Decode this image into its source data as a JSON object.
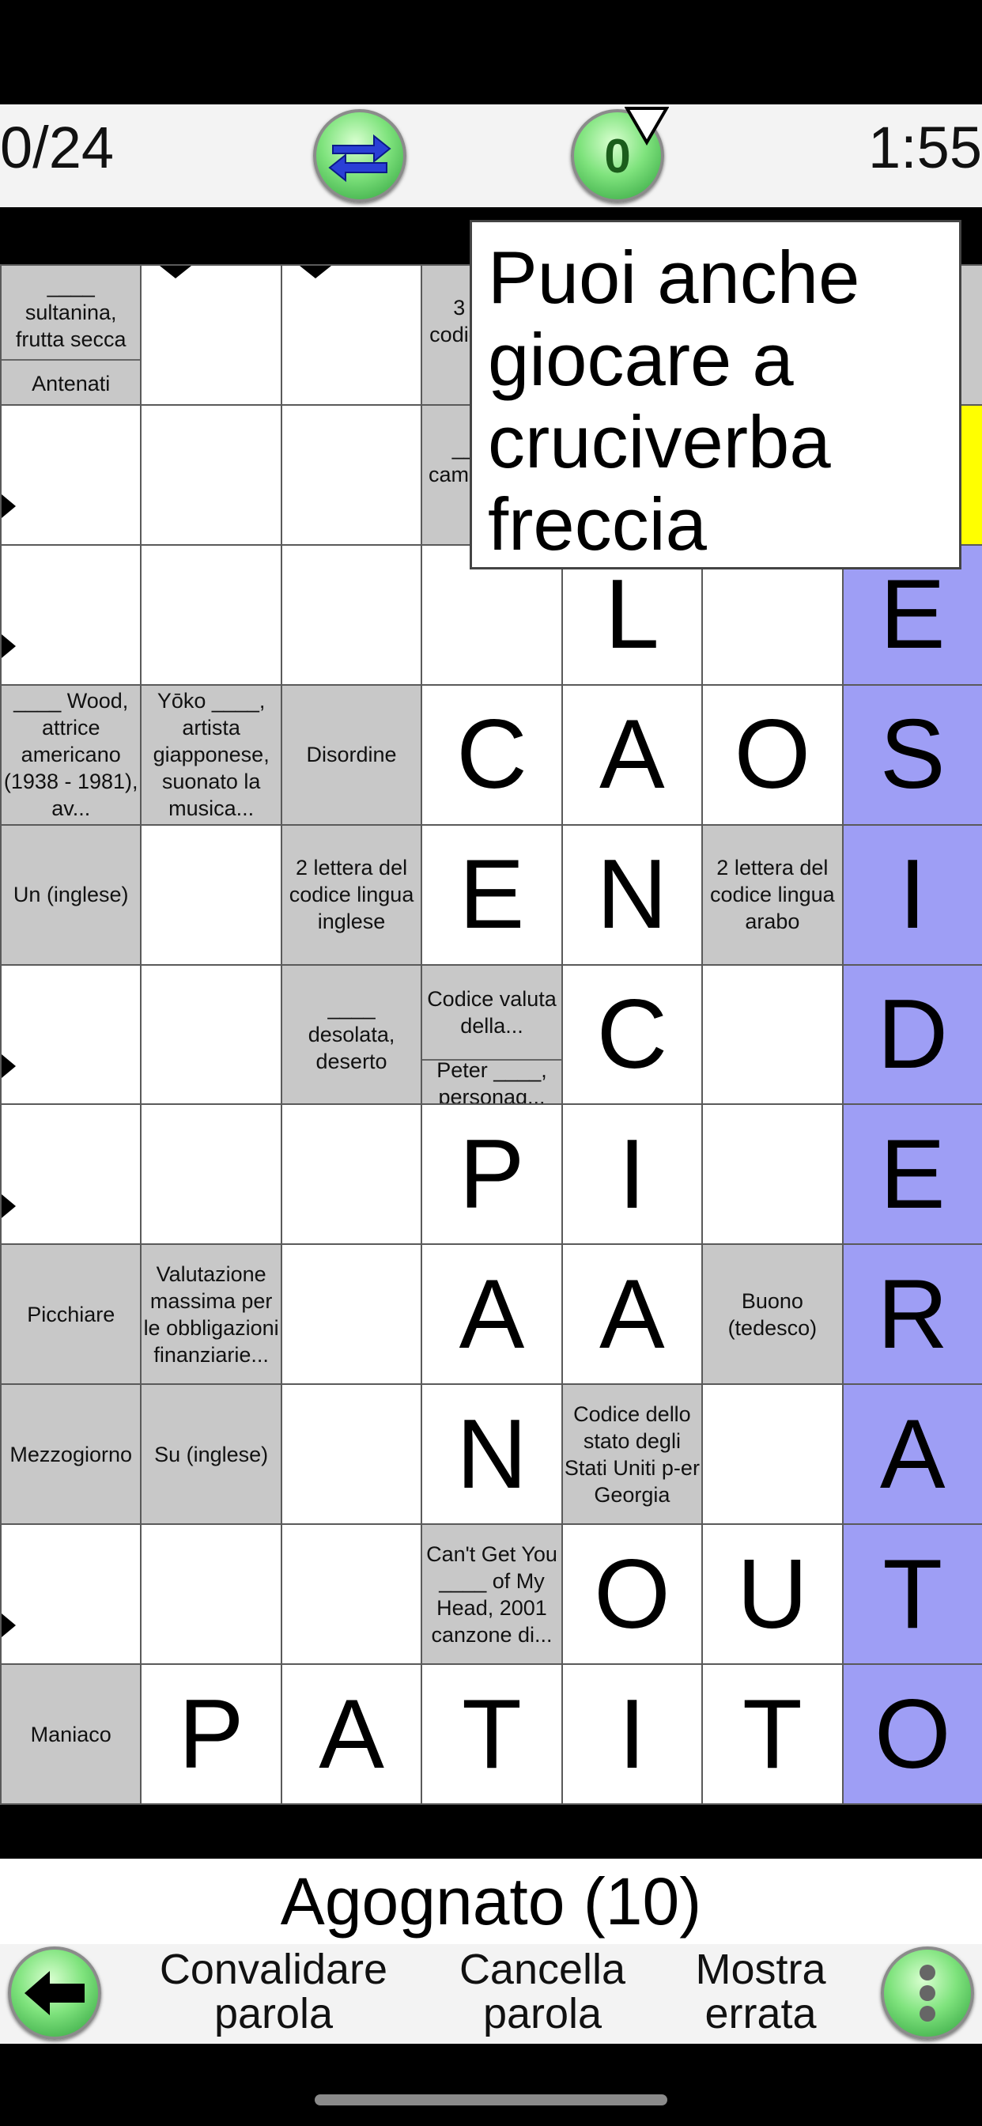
{
  "header": {
    "score": "0/24",
    "timer": "1:55",
    "hint_count": "0",
    "swap_icon": "swap-arrows-icon",
    "hint_icon": "hint-bulb-icon"
  },
  "tooltip": {
    "text": "Puoi anche giocare a cruciverba freccia"
  },
  "colors": {
    "clue_bg": "#c8c8c8",
    "highlight": "#9e9ef5",
    "selected": "#ffff00",
    "button_green": "#7fe37d"
  },
  "grid": {
    "cols": 7,
    "rows": 11,
    "cells": [
      {
        "r": 0,
        "c": 0,
        "type": "clue2",
        "top": "____ sultanina, frutta secca",
        "bottom": "Antenati"
      },
      {
        "r": 0,
        "c": 1,
        "type": "empty",
        "arrows": [
          "d"
        ]
      },
      {
        "r": 0,
        "c": 2,
        "type": "empty",
        "arrows": [
          "d"
        ]
      },
      {
        "r": 0,
        "c": 3,
        "type": "clue",
        "text": "3 lettere codice lingua lit..."
      },
      {
        "r": 0,
        "c": 4,
        "type": "empty"
      },
      {
        "r": 0,
        "c": 5,
        "type": "empty"
      },
      {
        "r": 0,
        "c": 6,
        "type": "clue",
        "text": ""
      },
      {
        "r": 1,
        "c": 0,
        "type": "empty",
        "arrows": [
          "r"
        ]
      },
      {
        "r": 1,
        "c": 1,
        "type": "empty"
      },
      {
        "r": 1,
        "c": 2,
        "type": "empty"
      },
      {
        "r": 1,
        "c": 3,
        "type": "clue",
        "text": "___ Spa cam... heav... ing..."
      },
      {
        "r": 1,
        "c": 4,
        "type": "empty"
      },
      {
        "r": 1,
        "c": 5,
        "type": "empty"
      },
      {
        "r": 1,
        "c": 6,
        "type": "yellow"
      },
      {
        "r": 2,
        "c": 0,
        "type": "empty",
        "arrows": [
          "r"
        ]
      },
      {
        "r": 2,
        "c": 1,
        "type": "empty"
      },
      {
        "r": 2,
        "c": 2,
        "type": "empty"
      },
      {
        "r": 2,
        "c": 3,
        "type": "empty"
      },
      {
        "r": 2,
        "c": 4,
        "type": "letter",
        "letter": "L"
      },
      {
        "r": 2,
        "c": 5,
        "type": "empty"
      },
      {
        "r": 2,
        "c": 6,
        "type": "letter",
        "letter": "E",
        "hl": true
      },
      {
        "r": 3,
        "c": 0,
        "type": "clue",
        "text": "____ Wood, attrice americano (1938 - 1981), av..."
      },
      {
        "r": 3,
        "c": 1,
        "type": "clue",
        "text": "Yōko ____, artista giapponese, suonato la musica...",
        "arrows": [
          "d"
        ]
      },
      {
        "r": 3,
        "c": 2,
        "type": "clue",
        "text": "Disordine",
        "arrows": [
          "r"
        ]
      },
      {
        "r": 3,
        "c": 3,
        "type": "letter",
        "letter": "C"
      },
      {
        "r": 3,
        "c": 4,
        "type": "letter",
        "letter": "A"
      },
      {
        "r": 3,
        "c": 5,
        "type": "letter",
        "letter": "O"
      },
      {
        "r": 3,
        "c": 6,
        "type": "letter",
        "letter": "S",
        "hl": true
      },
      {
        "r": 4,
        "c": 0,
        "type": "clue",
        "text": "Un (inglese)"
      },
      {
        "r": 4,
        "c": 1,
        "type": "empty"
      },
      {
        "r": 4,
        "c": 2,
        "type": "clue",
        "text": "2 lettera del codice lingua inglese",
        "arrows": [
          "r"
        ]
      },
      {
        "r": 4,
        "c": 3,
        "type": "letter",
        "letter": "E"
      },
      {
        "r": 4,
        "c": 4,
        "type": "letter",
        "letter": "N"
      },
      {
        "r": 4,
        "c": 5,
        "type": "clue",
        "text": "2 lettera del codice lingua arabo",
        "arrows": [
          "d"
        ]
      },
      {
        "r": 4,
        "c": 6,
        "type": "letter",
        "letter": "I",
        "hl": true
      },
      {
        "r": 5,
        "c": 0,
        "type": "empty",
        "arrows": [
          "r"
        ]
      },
      {
        "r": 5,
        "c": 1,
        "type": "empty"
      },
      {
        "r": 5,
        "c": 2,
        "type": "clue",
        "text": "____ desolata, deserto",
        "arrows": [
          "d"
        ]
      },
      {
        "r": 5,
        "c": 3,
        "type": "clue2",
        "top": "Codice valuta della...",
        "bottom": "Peter ____, personag...",
        "arrows": [
          "r",
          "d"
        ]
      },
      {
        "r": 5,
        "c": 4,
        "type": "letter",
        "letter": "C"
      },
      {
        "r": 5,
        "c": 5,
        "type": "empty"
      },
      {
        "r": 5,
        "c": 6,
        "type": "letter",
        "letter": "D",
        "hl": true
      },
      {
        "r": 6,
        "c": 0,
        "type": "empty",
        "arrows": [
          "r"
        ]
      },
      {
        "r": 6,
        "c": 1,
        "type": "empty"
      },
      {
        "r": 6,
        "c": 2,
        "type": "empty"
      },
      {
        "r": 6,
        "c": 3,
        "type": "letter",
        "letter": "P"
      },
      {
        "r": 6,
        "c": 4,
        "type": "letter",
        "letter": "I"
      },
      {
        "r": 6,
        "c": 5,
        "type": "empty"
      },
      {
        "r": 6,
        "c": 6,
        "type": "letter",
        "letter": "E",
        "hl": true
      },
      {
        "r": 7,
        "c": 0,
        "type": "clue",
        "text": "Picchiare"
      },
      {
        "r": 7,
        "c": 1,
        "type": "clue",
        "text": "Valutazione massima per le obbligazioni finanziarie...",
        "arrows": [
          "r"
        ]
      },
      {
        "r": 7,
        "c": 2,
        "type": "empty"
      },
      {
        "r": 7,
        "c": 3,
        "type": "letter",
        "letter": "A"
      },
      {
        "r": 7,
        "c": 4,
        "type": "letter",
        "letter": "A"
      },
      {
        "r": 7,
        "c": 5,
        "type": "clue",
        "text": "Buono (tedesco)",
        "arrows": [
          "d"
        ]
      },
      {
        "r": 7,
        "c": 6,
        "type": "letter",
        "letter": "R",
        "hl": true
      },
      {
        "r": 8,
        "c": 0,
        "type": "clue",
        "text": "Mezzogiorno"
      },
      {
        "r": 8,
        "c": 1,
        "type": "clue",
        "text": "Su (inglese)",
        "arrows": [
          "d"
        ]
      },
      {
        "r": 8,
        "c": 2,
        "type": "empty"
      },
      {
        "r": 8,
        "c": 3,
        "type": "letter",
        "letter": "N"
      },
      {
        "r": 8,
        "c": 4,
        "type": "clue",
        "text": "Codice dello stato degli Stati Uniti p-er Georgia",
        "arrows": [
          "r"
        ]
      },
      {
        "r": 8,
        "c": 5,
        "type": "empty"
      },
      {
        "r": 8,
        "c": 6,
        "type": "letter",
        "letter": "A",
        "hl": true
      },
      {
        "r": 9,
        "c": 0,
        "type": "empty",
        "arrows": [
          "r"
        ]
      },
      {
        "r": 9,
        "c": 1,
        "type": "empty"
      },
      {
        "r": 9,
        "c": 2,
        "type": "empty"
      },
      {
        "r": 9,
        "c": 3,
        "type": "clue",
        "text": "Can't Get You ____ of My Head, 2001 canzone di...",
        "arrows": [
          "r"
        ]
      },
      {
        "r": 9,
        "c": 4,
        "type": "letter",
        "letter": "O"
      },
      {
        "r": 9,
        "c": 5,
        "type": "letter",
        "letter": "U"
      },
      {
        "r": 9,
        "c": 6,
        "type": "letter",
        "letter": "T",
        "hl": true
      },
      {
        "r": 10,
        "c": 0,
        "type": "clue",
        "text": "Maniaco",
        "arrows": [
          "r"
        ]
      },
      {
        "r": 10,
        "c": 1,
        "type": "letter",
        "letter": "P"
      },
      {
        "r": 10,
        "c": 2,
        "type": "letter",
        "letter": "A"
      },
      {
        "r": 10,
        "c": 3,
        "type": "letter",
        "letter": "T"
      },
      {
        "r": 10,
        "c": 4,
        "type": "letter",
        "letter": "I"
      },
      {
        "r": 10,
        "c": 5,
        "type": "letter",
        "letter": "T"
      },
      {
        "r": 10,
        "c": 6,
        "type": "letter",
        "letter": "O",
        "hl": true
      }
    ]
  },
  "clue_bar": {
    "text": "Agognato (10)"
  },
  "bottom": {
    "back_icon": "back-arrow-icon",
    "validate": "Convalidare parola",
    "clear": "Cancella parola",
    "show_wrong": "Mostra errata",
    "menu_icon": "more-vertical-icon"
  }
}
